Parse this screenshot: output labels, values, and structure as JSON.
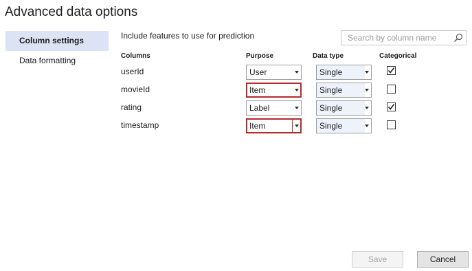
{
  "window": {
    "title": "Advanced data options"
  },
  "sidebar": {
    "items": [
      {
        "label": "Column settings",
        "active": true
      },
      {
        "label": "Data formatting",
        "active": false
      }
    ]
  },
  "main": {
    "include_label": "Include features to use for prediction",
    "search": {
      "placeholder": "Search by column name",
      "value": "",
      "icon": "search-icon"
    },
    "headers": {
      "columns": "Columns",
      "purpose": "Purpose",
      "data_type": "Data type",
      "categorical": "Categorical"
    },
    "rows": [
      {
        "column": "userId",
        "purpose": "User",
        "data_type": "Single",
        "categorical": true,
        "purpose_highlight": false
      },
      {
        "column": "movieId",
        "purpose": "Item",
        "data_type": "Single",
        "categorical": false,
        "purpose_highlight": true
      },
      {
        "column": "rating",
        "purpose": "Label",
        "data_type": "Single",
        "categorical": true,
        "purpose_highlight": false
      },
      {
        "column": "timestamp",
        "purpose": "Item",
        "data_type": "Single",
        "categorical": false,
        "purpose_highlight": true
      }
    ]
  },
  "footer": {
    "save_label": "Save",
    "save_enabled": false,
    "cancel_label": "Cancel"
  },
  "colors": {
    "accent_bg": "#dbe3f4",
    "error_border": "#b52b2b"
  }
}
